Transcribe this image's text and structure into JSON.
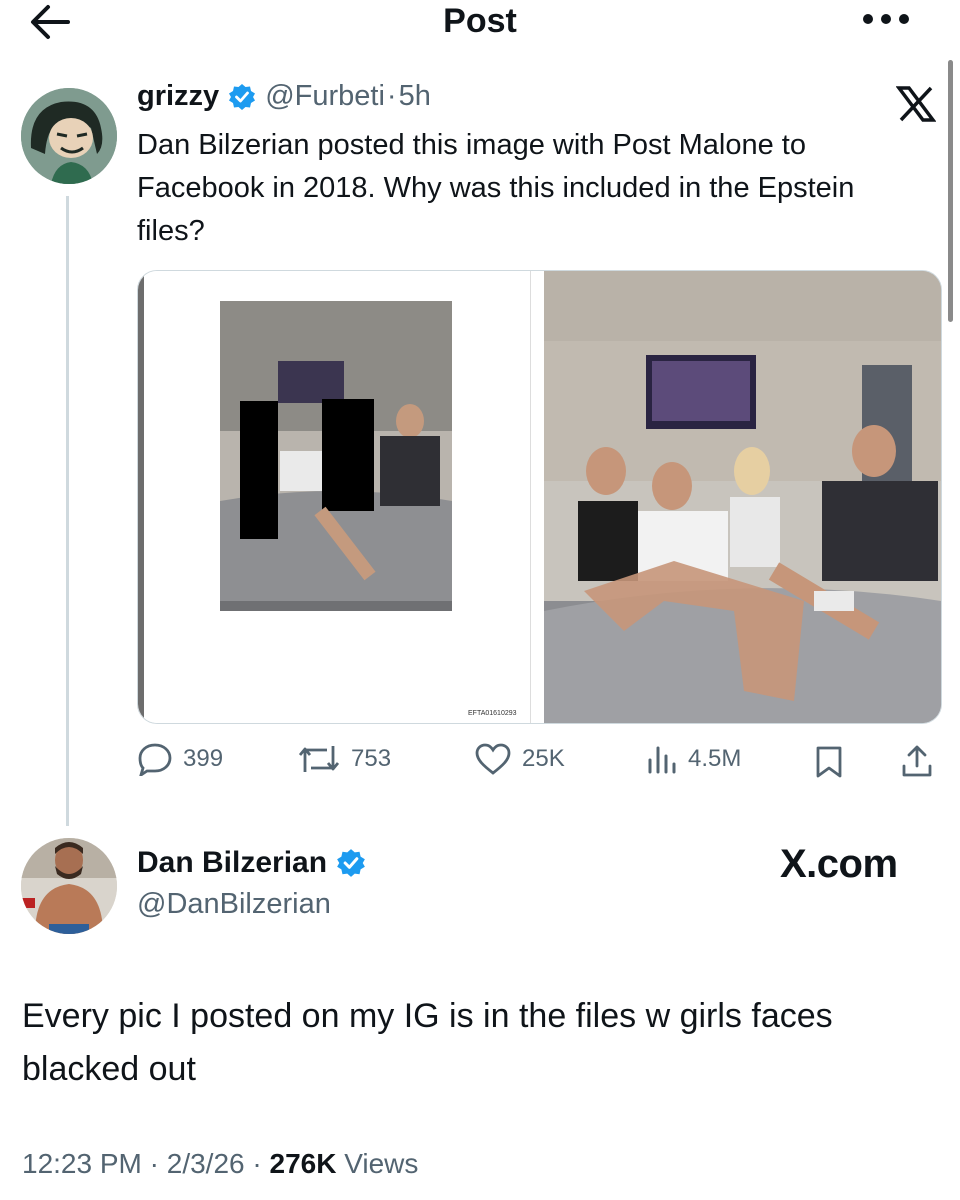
{
  "header": {
    "title": "Post"
  },
  "tweet": {
    "name": "grizzy",
    "handle": "@Furbeti",
    "separator": "·",
    "time": "5h",
    "text": "Dan Bilzerian posted this image with Post Malone to Facebook in 2018. Why was this included in the Epstein files?",
    "media_doc_id": "EFTA01610293",
    "stats": {
      "replies": "399",
      "reposts": "753",
      "likes": "25K",
      "views": "4.5M"
    }
  },
  "quoted": {
    "name": "Dan Bilzerian",
    "handle": "@DanBilzerian",
    "brand": "X.com",
    "text": "Every pic I posted on my IG is in the files w girls faces blacked out",
    "time": "12:23 PM",
    "date": "2/3/26",
    "views_count": "276K",
    "views_label": "Views",
    "separator": "·"
  },
  "icons": [
    "back-arrow-icon",
    "more-icon",
    "verified-badge-icon",
    "x-logo-icon",
    "reply-icon",
    "repost-icon",
    "like-icon",
    "views-icon",
    "bookmark-icon",
    "share-icon"
  ],
  "colors": {
    "verified": "#1d9bf0",
    "muted": "#536471",
    "text": "#0f1419"
  }
}
